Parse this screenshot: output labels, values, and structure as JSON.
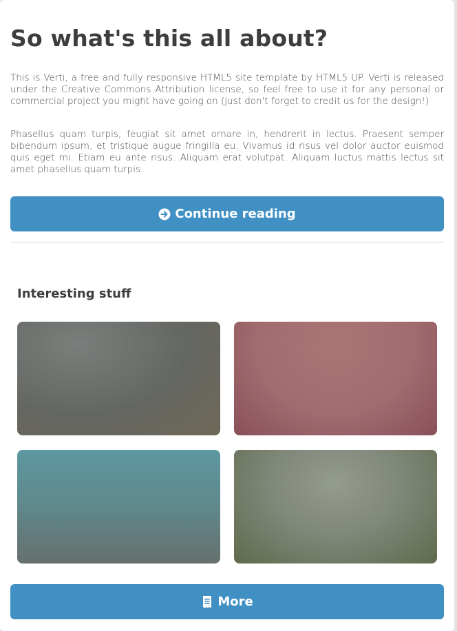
{
  "main": {
    "title": "So what's this all about?",
    "paragraphs": [
      "This is Verti, a free and fully responsive HTML5 site template by HTML5 UP. Verti is released under the Creative Commons Attribution license, so feel free to use it for any personal or commercial project you might have going on (just don't forget to credit us for the design!)",
      "Phasellus quam turpis, feugiat sit amet ornare in, hendrerit in lectus. Praesent semper bibendum ipsum, et tristique augue fringilla eu. Vivamus id risus vel dolor auctor euismod quis eget mi. Etiam eu ante risus. Aliquam erat volutpat. Aliquam luctus mattis lectus sit amet phasellus quam turpis."
    ],
    "continue_button": {
      "label": "Continue reading",
      "icon": "arrow-circle-right-icon"
    }
  },
  "interesting": {
    "title": "Interesting stuff",
    "tiles": [
      {
        "name": "gray-photo"
      },
      {
        "name": "rose-photo"
      },
      {
        "name": "teal-photo"
      },
      {
        "name": "olive-photo"
      }
    ],
    "more_button": {
      "label": "More",
      "icon": "receipt-icon"
    }
  },
  "colors": {
    "accent": "#4090c4",
    "heading": "#3d3d3d",
    "text": "#4a4a4a",
    "background": "#ffffff",
    "page": "#e5e5e5"
  }
}
